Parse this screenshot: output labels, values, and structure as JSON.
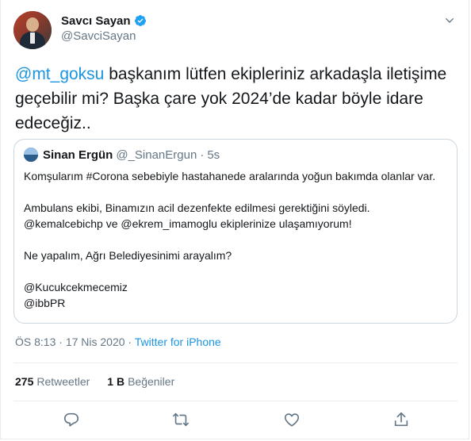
{
  "author": {
    "display_name": "Savcı Sayan",
    "handle": "@SavciSayan",
    "verified": true
  },
  "tweet": {
    "mention": "@mt_goksu",
    "text": " başkanım lütfen ekipleriniz arkadaşla iletişime geçebilir mi? Başka çare yok 2024’de kadar böyle idare edeceğiz.."
  },
  "quoted_tweet": {
    "display_name": "Sinan Ergün",
    "handle": "@_SinanErgun",
    "separator": "·",
    "time": "5s",
    "lines": [
      "Komşularım #Corona sebebiyle hastahanede aralarında yoğun bakımda olanlar var.",
      "",
      "Ambulans ekibi, Binamızın acil dezenfekte edilmesi gerektiğini söyledi. @kemalcebichp ve @ekrem_imamoglu ekiplerinize ulaşamıyorum!",
      "",
      "Ne yapalım, Ağrı Belediyesinimi arayalım?",
      "",
      "@Kucukcekmecemiz",
      "@ibbPR"
    ]
  },
  "meta": {
    "time": "ÖS 8:13",
    "separator1": " · ",
    "date": "17 Nis 2020",
    "separator2": " · ",
    "source": "Twitter for iPhone"
  },
  "stats": {
    "retweets_count": "275",
    "retweets_label": "Retweetler",
    "likes_count": "1 B",
    "likes_label": "Beğeniler"
  },
  "icons": {
    "accent": "#1da1f2",
    "muted": "#657786",
    "reply": "reply-icon",
    "retweet": "retweet-icon",
    "like": "like-icon",
    "share": "share-icon"
  }
}
